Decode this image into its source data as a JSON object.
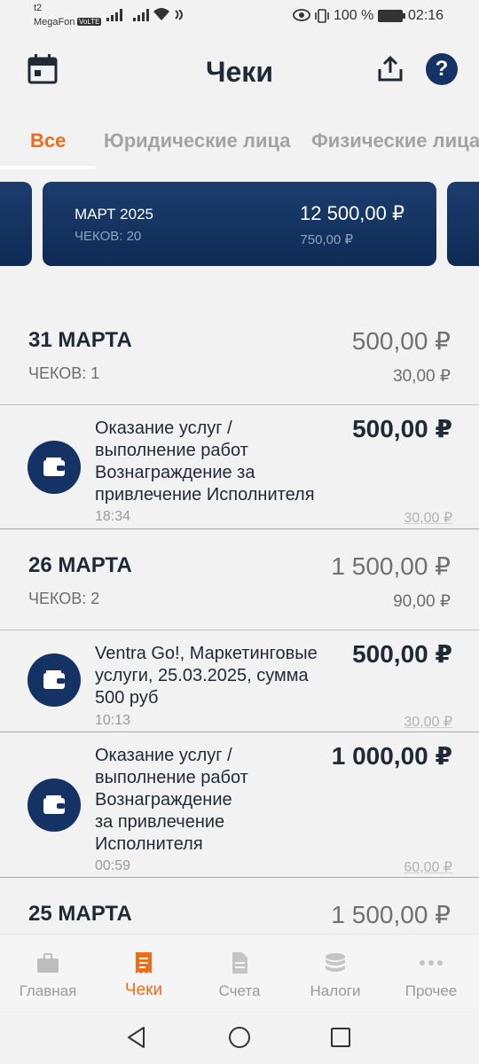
{
  "status_bar": {
    "operator_line1": "t2",
    "operator_line2": "MegaFon",
    "volte": "VoLTE",
    "battery_percent": "100 %",
    "time": "02:16"
  },
  "header": {
    "title": "Чеки",
    "icons": [
      "calendar-icon",
      "share-icon",
      "help-icon"
    ],
    "help_label": "?"
  },
  "tabs": [
    {
      "label": "Все",
      "active": true
    },
    {
      "label": "Юридические лица",
      "active": false
    },
    {
      "label": "Физические лица",
      "active": false
    }
  ],
  "period_card": {
    "month": "МАРТ 2025",
    "count": "ЧЕКОВ: 20",
    "amount": "12 500,00 ₽",
    "tax": "750,00 ₽"
  },
  "days": [
    {
      "date": "31 МАРТА",
      "count": "ЧЕКОВ: 1",
      "sum": "500,00 ₽",
      "tax": "30,00 ₽",
      "receipts": [
        {
          "lines": [
            "Оказание услуг /",
            "выполнение работ",
            "Вознаграждение за",
            "привлечение Исполнителя"
          ],
          "time": "18:34",
          "sum": "500,00 ₽",
          "tax": "30,00 ₽"
        }
      ]
    },
    {
      "date": "26 МАРТА",
      "count": "ЧЕКОВ: 2",
      "sum": "1 500,00 ₽",
      "tax": "90,00 ₽",
      "receipts": [
        {
          "lines": [
            "Ventra Go!, Маркетинговые",
            "услуги, 25.03.2025, сумма",
            "500 руб"
          ],
          "time": "10:13",
          "sum": "500,00 ₽",
          "tax": "30,00 ₽"
        },
        {
          "lines": [
            "Оказание услуг /",
            "выполнение работ",
            "Вознаграждение",
            "за привлечение",
            "Исполнителя"
          ],
          "time": "00:59",
          "sum": "1 000,00 ₽",
          "tax": "60,00 ₽"
        }
      ]
    },
    {
      "date": "25 МАРТА",
      "sum": "1 500,00 ₽"
    }
  ],
  "bottom_nav": [
    {
      "label": "Главная",
      "icon": "briefcase-icon",
      "active": false
    },
    {
      "label": "Чеки",
      "icon": "receipt-icon",
      "active": true
    },
    {
      "label": "Счета",
      "icon": "document-icon",
      "active": false
    },
    {
      "label": "Налоги",
      "icon": "coins-icon",
      "active": false
    },
    {
      "label": "Прочее",
      "icon": "more-icon",
      "active": false
    }
  ],
  "system_nav": [
    "back-icon",
    "home-icon",
    "recents-icon"
  ],
  "colors": {
    "primary_navy": "#143263",
    "accent_orange": "#ee6d1b",
    "background": "#f2f2f2"
  }
}
